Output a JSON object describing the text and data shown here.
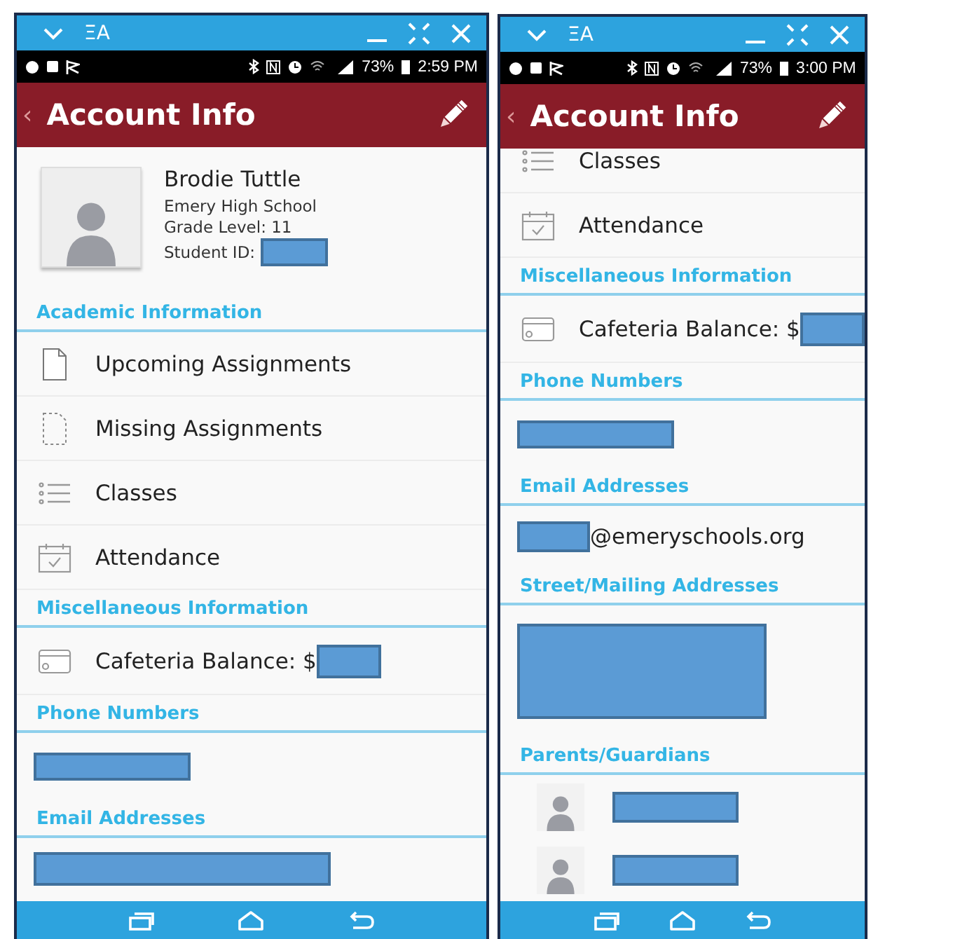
{
  "screens": [
    {
      "scrolled": false,
      "window_bar": {
        "menu_glyph": "ΞA"
      },
      "status_bar": {
        "battery": "73%",
        "time": "2:59 PM"
      },
      "header": {
        "back": "‹",
        "title": "Account Info"
      },
      "rows": [
        {
          "kind": "profile",
          "name": "Brodie Tuttle",
          "school": "Emery High School",
          "grade": "Grade Level: 11",
          "student_id": "Student ID:"
        },
        {
          "kind": "heading",
          "text": "Academic Information"
        },
        {
          "kind": "document",
          "text": "Upcoming Assignments"
        },
        {
          "kind": "draft",
          "text": "Missing Assignments"
        },
        {
          "kind": "list",
          "text": "Classes"
        },
        {
          "kind": "calendar",
          "text": "Attendance"
        },
        {
          "kind": "heading",
          "text": "Miscellaneous Information"
        },
        {
          "kind": "card",
          "text": "Cafeteria Balance: $"
        },
        {
          "kind": "heading",
          "text": "Phone Numbers"
        },
        {
          "kind": "phone"
        },
        {
          "kind": "heading",
          "text": "Email Addresses"
        },
        {
          "kind": "email"
        }
      ]
    },
    {
      "scrolled": true,
      "window_bar": {
        "menu_glyph": "ΞA"
      },
      "status_bar": {
        "battery": "73%",
        "time": "3:00 PM"
      },
      "header": {
        "back": "‹",
        "title": "Account Info"
      },
      "rows": [
        {
          "kind": "list",
          "text": "Classes"
        },
        {
          "kind": "calendar",
          "text": "Attendance"
        },
        {
          "kind": "heading",
          "text": "Miscellaneous Information"
        },
        {
          "kind": "card",
          "text": "Cafeteria Balance: $"
        },
        {
          "kind": "heading",
          "text": "Phone Numbers"
        },
        {
          "kind": "phone"
        },
        {
          "kind": "heading",
          "text": "Email Addresses"
        },
        {
          "kind": "email",
          "text": "@emeryschools.org"
        },
        {
          "kind": "heading",
          "text": "Street/Mailing Addresses"
        },
        {
          "kind": "address"
        },
        {
          "kind": "heading",
          "text": "Parents/Guardians"
        },
        {
          "kind": "parent"
        },
        {
          "kind": "parent"
        }
      ]
    }
  ]
}
